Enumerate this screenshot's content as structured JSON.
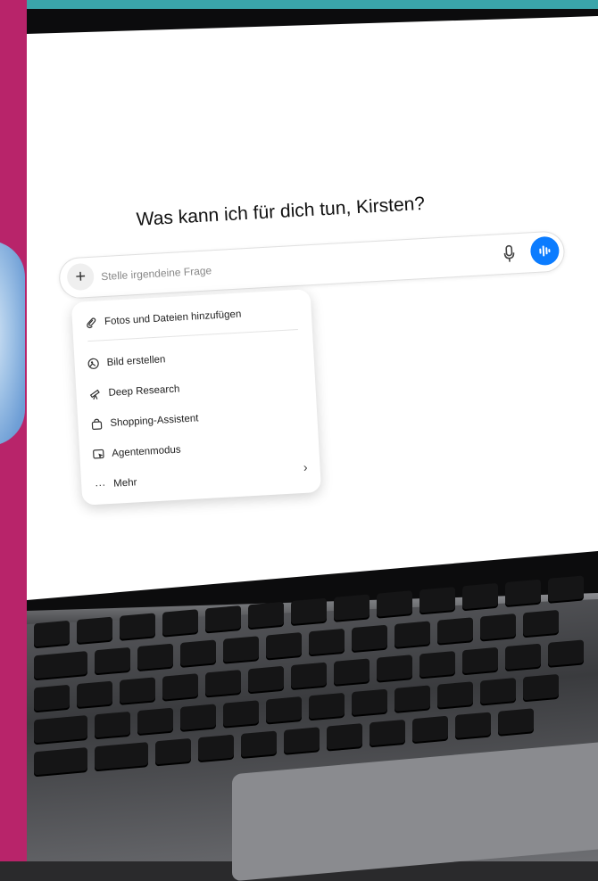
{
  "greeting": "Was kann ich für dich tun, Kirsten?",
  "prompt": {
    "placeholder": "Stelle irgendeine Frage",
    "plus_label": "+"
  },
  "menu": {
    "items": [
      {
        "label": "Fotos und Dateien hinzufügen",
        "icon": "paperclip-icon"
      },
      {
        "label": "Bild erstellen",
        "icon": "image-create-icon"
      },
      {
        "label": "Deep Research",
        "icon": "telescope-icon"
      },
      {
        "label": "Shopping-Assistent",
        "icon": "shopping-bag-icon"
      },
      {
        "label": "Agentenmodus",
        "icon": "agent-icon"
      },
      {
        "label": "Mehr",
        "icon": "more-dots-icon"
      }
    ],
    "more_chevron": "›"
  },
  "colors": {
    "accent": "#0b7cff",
    "left_strip": "#b8246a",
    "top_strip": "#3aa5aa"
  }
}
